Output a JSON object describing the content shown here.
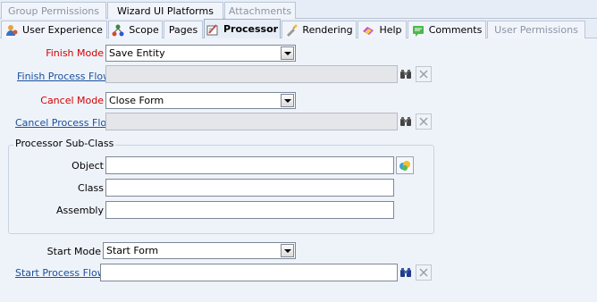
{
  "tabs_row1": [
    {
      "label": "Group Permissions",
      "state": "disabled"
    },
    {
      "label": "Wizard UI Platforms",
      "state": "normal"
    },
    {
      "label": "Attachments",
      "state": "disabled"
    }
  ],
  "tabs_row2": [
    {
      "label": "User Experience",
      "icon": "user-experience-icon"
    },
    {
      "label": "Scope",
      "icon": "scope-icon"
    },
    {
      "label": "Pages",
      "icon": ""
    },
    {
      "label": "Processor",
      "icon": "processor-icon"
    },
    {
      "label": "Rendering",
      "icon": "rendering-icon"
    },
    {
      "label": "Help",
      "icon": "help-icon"
    },
    {
      "label": "Comments",
      "icon": "comments-icon"
    },
    {
      "label": "User Permissions",
      "icon": ""
    }
  ],
  "form": {
    "finish_mode_label": "Finish Mode",
    "finish_mode_value": "Save Entity",
    "finish_process_flow_label": "Finish Process Flow",
    "cancel_mode_label": "Cancel Mode",
    "cancel_mode_value": "Close Form",
    "cancel_process_flow_label": "Cancel Process Flow",
    "processor_subclass_title": "Processor Sub-Class",
    "object_label": "Object",
    "class_label": "Class",
    "assembly_label": "Assembly",
    "start_mode_label": "Start Mode",
    "start_mode_value": "Start Form",
    "start_process_flow_label": "Start Process Flow"
  },
  "colors": {
    "required_label": "#d40000",
    "link": "#1a4f9c",
    "background": "#eef3fa"
  }
}
